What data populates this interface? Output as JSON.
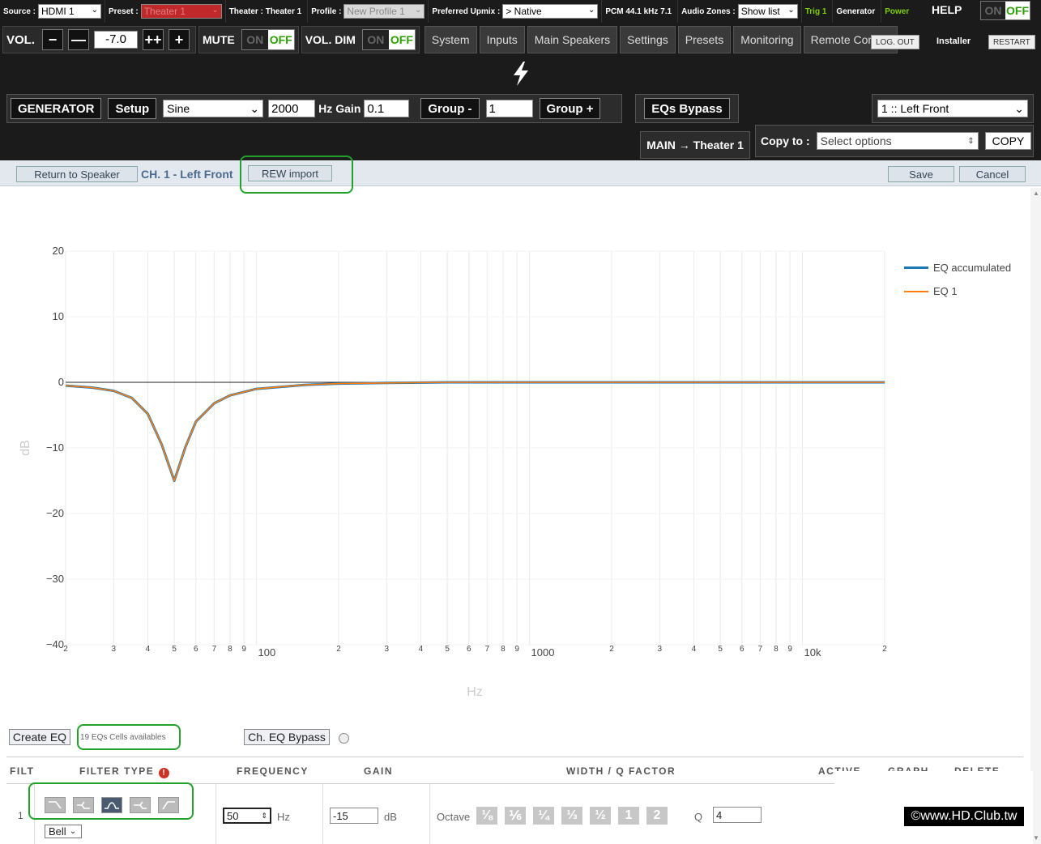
{
  "topbar": {
    "source_label": "Source :",
    "source_value": "HDMI 1",
    "preset_label": "Preset :",
    "preset_value": "Theater 1",
    "theater_label": "Theater : Theater 1",
    "profile_label": "Profile :",
    "profile_value": "New Profile 1",
    "upmix_label": "Preferred Upmix :",
    "upmix_value": "> Native",
    "pcm_label": "PCM 44.1 kHz 7.1",
    "zones_label": "Audio Zones :",
    "zones_value": "Show list",
    "trig_label": "Trig 1",
    "generator_label": "Generator",
    "power_label": "Power",
    "help_label": "HELP",
    "on_label": "ON",
    "off_label": "OFF"
  },
  "volume": {
    "label": "VOL.",
    "minus": "−",
    "minus2": "—",
    "value": "-7.0",
    "plus2": "++",
    "plus": "+",
    "mute_label": "MUTE",
    "dim_label": "VOL. DIM",
    "on_label": "ON",
    "off_label": "OFF"
  },
  "nav": {
    "tabs": [
      "System",
      "Inputs",
      "Main Speakers",
      "Settings",
      "Presets",
      "Monitoring",
      "Remote Control"
    ],
    "logout": "LOG. OUT",
    "installer": "Installer",
    "restart": "RESTART"
  },
  "generator": {
    "gen_btn": "GENERATOR",
    "setup_btn": "Setup",
    "wave_value": "Sine",
    "freq_value": "2000",
    "freq_unit": "Hz",
    "gain_label": "Gain",
    "gain_value": "0.1",
    "group_minus": "Group -",
    "group_value": "1",
    "group_plus": "Group +",
    "eq_bypass": "EQs Bypass",
    "channel_value": "1 :: Left Front"
  },
  "copy": {
    "main_theater": "MAIN → Theater 1",
    "copy_to_label": "Copy to :",
    "placeholder": "Select options",
    "copy_btn": "COPY"
  },
  "toolbar": {
    "return_btn": "Return to Speaker",
    "channel_label": "CH. 1 - Left Front",
    "rew_btn": "REW import",
    "save_btn": "Save",
    "cancel_btn": "Cancel"
  },
  "chart_data": {
    "type": "line",
    "xlabel": "Hz",
    "ylabel": "dB",
    "xscale": "log",
    "xlim": [
      20,
      20000
    ],
    "ylim": [
      -40,
      20
    ],
    "yticks": [
      "20",
      "10",
      "0",
      "−10",
      "−20",
      "−30",
      "−40"
    ],
    "xtick_labels": [
      "2",
      "3",
      "4",
      "5",
      "6",
      "7",
      "8",
      "9",
      "100",
      "2",
      "3",
      "4",
      "5",
      "6",
      "7",
      "8",
      "9",
      "1000",
      "2",
      "3",
      "4",
      "5",
      "6",
      "7",
      "8",
      "9",
      "10k",
      "2"
    ],
    "grid": true,
    "legend_position": "top-right",
    "series": [
      {
        "name": "EQ accumulated",
        "color": "#1f77b4",
        "x": [
          20,
          25,
          30,
          35,
          40,
          45,
          50,
          55,
          60,
          70,
          80,
          100,
          150,
          200,
          300,
          500,
          1000,
          2000,
          5000,
          10000,
          20000
        ],
        "y": [
          -0.5,
          -0.8,
          -1.3,
          -2.4,
          -4.8,
          -9.5,
          -15.0,
          -9.8,
          -6.0,
          -3.2,
          -2.0,
          -1.0,
          -0.4,
          -0.2,
          -0.1,
          0,
          0,
          0,
          0,
          0,
          0
        ]
      },
      {
        "name": "EQ 1",
        "color": "#ff7f0e",
        "x": [
          20,
          25,
          30,
          35,
          40,
          45,
          50,
          55,
          60,
          70,
          80,
          100,
          150,
          200,
          300,
          500,
          1000,
          2000,
          5000,
          10000,
          20000
        ],
        "y": [
          -0.5,
          -0.8,
          -1.3,
          -2.4,
          -4.8,
          -9.5,
          -15.0,
          -9.8,
          -6.0,
          -3.2,
          -2.0,
          -1.0,
          -0.4,
          -0.2,
          -0.1,
          0,
          0,
          0,
          0,
          0,
          0
        ]
      }
    ]
  },
  "eq_controls": {
    "create_btn": "Create EQ",
    "cells_label": "19 EQs Cells availables",
    "bypass_btn": "Ch. EQ Bypass"
  },
  "table": {
    "headers": {
      "filt": "FILT",
      "filter_type": "FILTER TYPE",
      "frequency": "FREQUENCY",
      "gain": "GAIN",
      "width": "WIDTH / Q FACTOR",
      "active": "ACTIVE",
      "graph": "GRAPH",
      "delete": "DELETE"
    },
    "warn_symbol": "!",
    "row": {
      "index": "1",
      "filter_value": "Bell",
      "frequency_value": "50",
      "freq_unit": "Hz",
      "gain_value": "-15",
      "gain_unit": "dB",
      "octave_label": "Octave",
      "octave_options": [
        "⅛",
        "⅙",
        "¼",
        "⅓",
        "½",
        "1",
        "2"
      ],
      "q_label": "Q",
      "q_value": "4"
    }
  },
  "watermark": "©www.HD.Club.tw"
}
